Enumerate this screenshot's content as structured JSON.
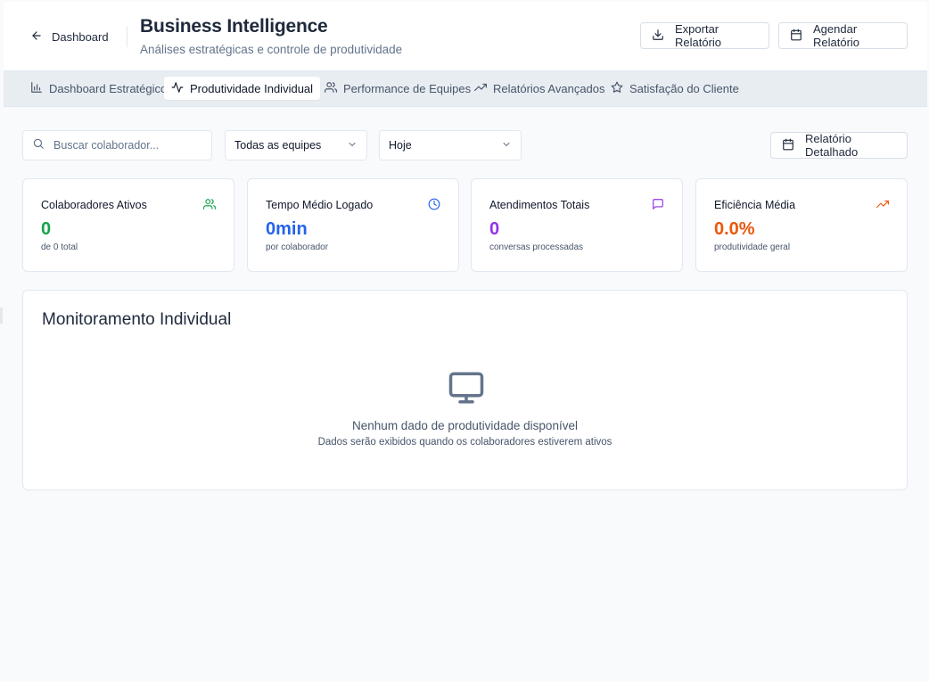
{
  "header": {
    "back_label": "Dashboard",
    "title": "Business Intelligence",
    "subtitle": "Análises estratégicas e controle de produtividade",
    "export_label": "Exportar Relatório",
    "schedule_label": "Agendar Relatório"
  },
  "tabs": [
    {
      "label": "Dashboard Estratégico",
      "icon": "bar-chart-icon",
      "active": false
    },
    {
      "label": "Produtividade Individual",
      "icon": "activity-icon",
      "active": true
    },
    {
      "label": "Performance de Equipes",
      "icon": "users-icon",
      "active": false
    },
    {
      "label": "Relatórios Avançados",
      "icon": "trending-up-icon",
      "active": false
    },
    {
      "label": "Satisfação do Cliente",
      "icon": "star-icon",
      "active": false
    }
  ],
  "filters": {
    "search_placeholder": "Buscar colaborador...",
    "team_select": "Todas as equipes",
    "period_select": "Hoje",
    "detail_button": "Relatório Detalhado"
  },
  "stats": [
    {
      "label": "Colaboradores Ativos",
      "value": "0",
      "sub": "de 0 total",
      "icon": "users-icon",
      "color": "#16a34a"
    },
    {
      "label": "Tempo Médio Logado",
      "value": "0min",
      "sub": "por colaborador",
      "icon": "clock-icon",
      "color": "#2563eb"
    },
    {
      "label": "Atendimentos Totais",
      "value": "0",
      "sub": "conversas processadas",
      "icon": "message-square-icon",
      "color": "#9333ea"
    },
    {
      "label": "Eficiência Média",
      "value": "0.0%",
      "sub": "produtividade geral",
      "icon": "trending-up-icon",
      "color": "#ea580c"
    }
  ],
  "monitoring": {
    "title": "Monitoramento Individual",
    "empty_title": "Nenhum dado de produtividade disponível",
    "empty_subtitle": "Dados serão exibidos quando os colaboradores estiverem ativos",
    "empty_icon": "monitor-icon"
  }
}
